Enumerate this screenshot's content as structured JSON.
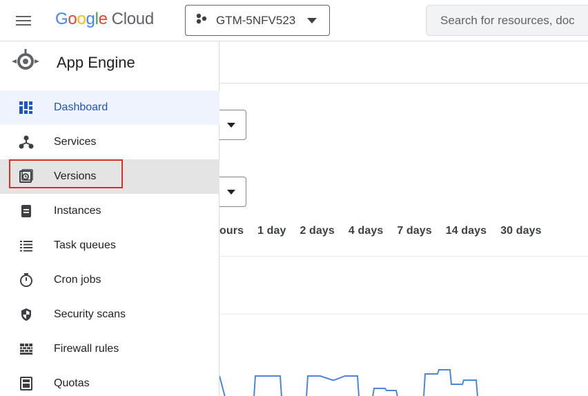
{
  "topbar": {
    "menu_icon": "hamburger-menu-icon",
    "logo_google": [
      "G",
      "o",
      "o",
      "g",
      "l",
      "e"
    ],
    "logo_google_colors": [
      "#4285F4",
      "#EA4335",
      "#FBBC05",
      "#4285F4",
      "#34A853",
      "#EA4335"
    ],
    "logo_cloud": "Cloud",
    "project_name": "GTM-5NFV523",
    "project_icon": "project-hexagon-icon",
    "search_placeholder": "Search for resources, doc"
  },
  "sidebar": {
    "product_title": "App Engine",
    "product_icon": "app-engine-icon",
    "items": [
      {
        "label": "Dashboard",
        "icon": "dashboard-icon",
        "active": true
      },
      {
        "label": "Services",
        "icon": "services-icon"
      },
      {
        "label": "Versions",
        "icon": "versions-icon",
        "hovered": true,
        "highlighted": true
      },
      {
        "label": "Instances",
        "icon": "instances-icon"
      },
      {
        "label": "Task queues",
        "icon": "task-queues-icon"
      },
      {
        "label": "Cron jobs",
        "icon": "timer-icon"
      },
      {
        "label": "Security scans",
        "icon": "shield-icon"
      },
      {
        "label": "Firewall rules",
        "icon": "firewall-icon"
      },
      {
        "label": "Quotas",
        "icon": "quotas-icon"
      }
    ]
  },
  "main": {
    "time_ranges": [
      "ours",
      "1 day",
      "2 days",
      "4 days",
      "7 days",
      "14 days",
      "30 days"
    ]
  },
  "colors": {
    "accent": "#1a56c9",
    "active_bg": "#eef3fd",
    "hover_bg": "#e4e4e4",
    "highlight": "#d93025",
    "chart_line": "#4a86d9"
  },
  "chart_data": {
    "type": "line",
    "series": [
      {
        "values": [
          1,
          0,
          0,
          1,
          1,
          0,
          0,
          1,
          1,
          0.8,
          0.8,
          1,
          1,
          0,
          0,
          0.4,
          0.4,
          0.3,
          0.3,
          0,
          0,
          1.1,
          1.1,
          1.3,
          1.3,
          0.6,
          0.6,
          0.8,
          0.8,
          0
        ]
      }
    ]
  }
}
